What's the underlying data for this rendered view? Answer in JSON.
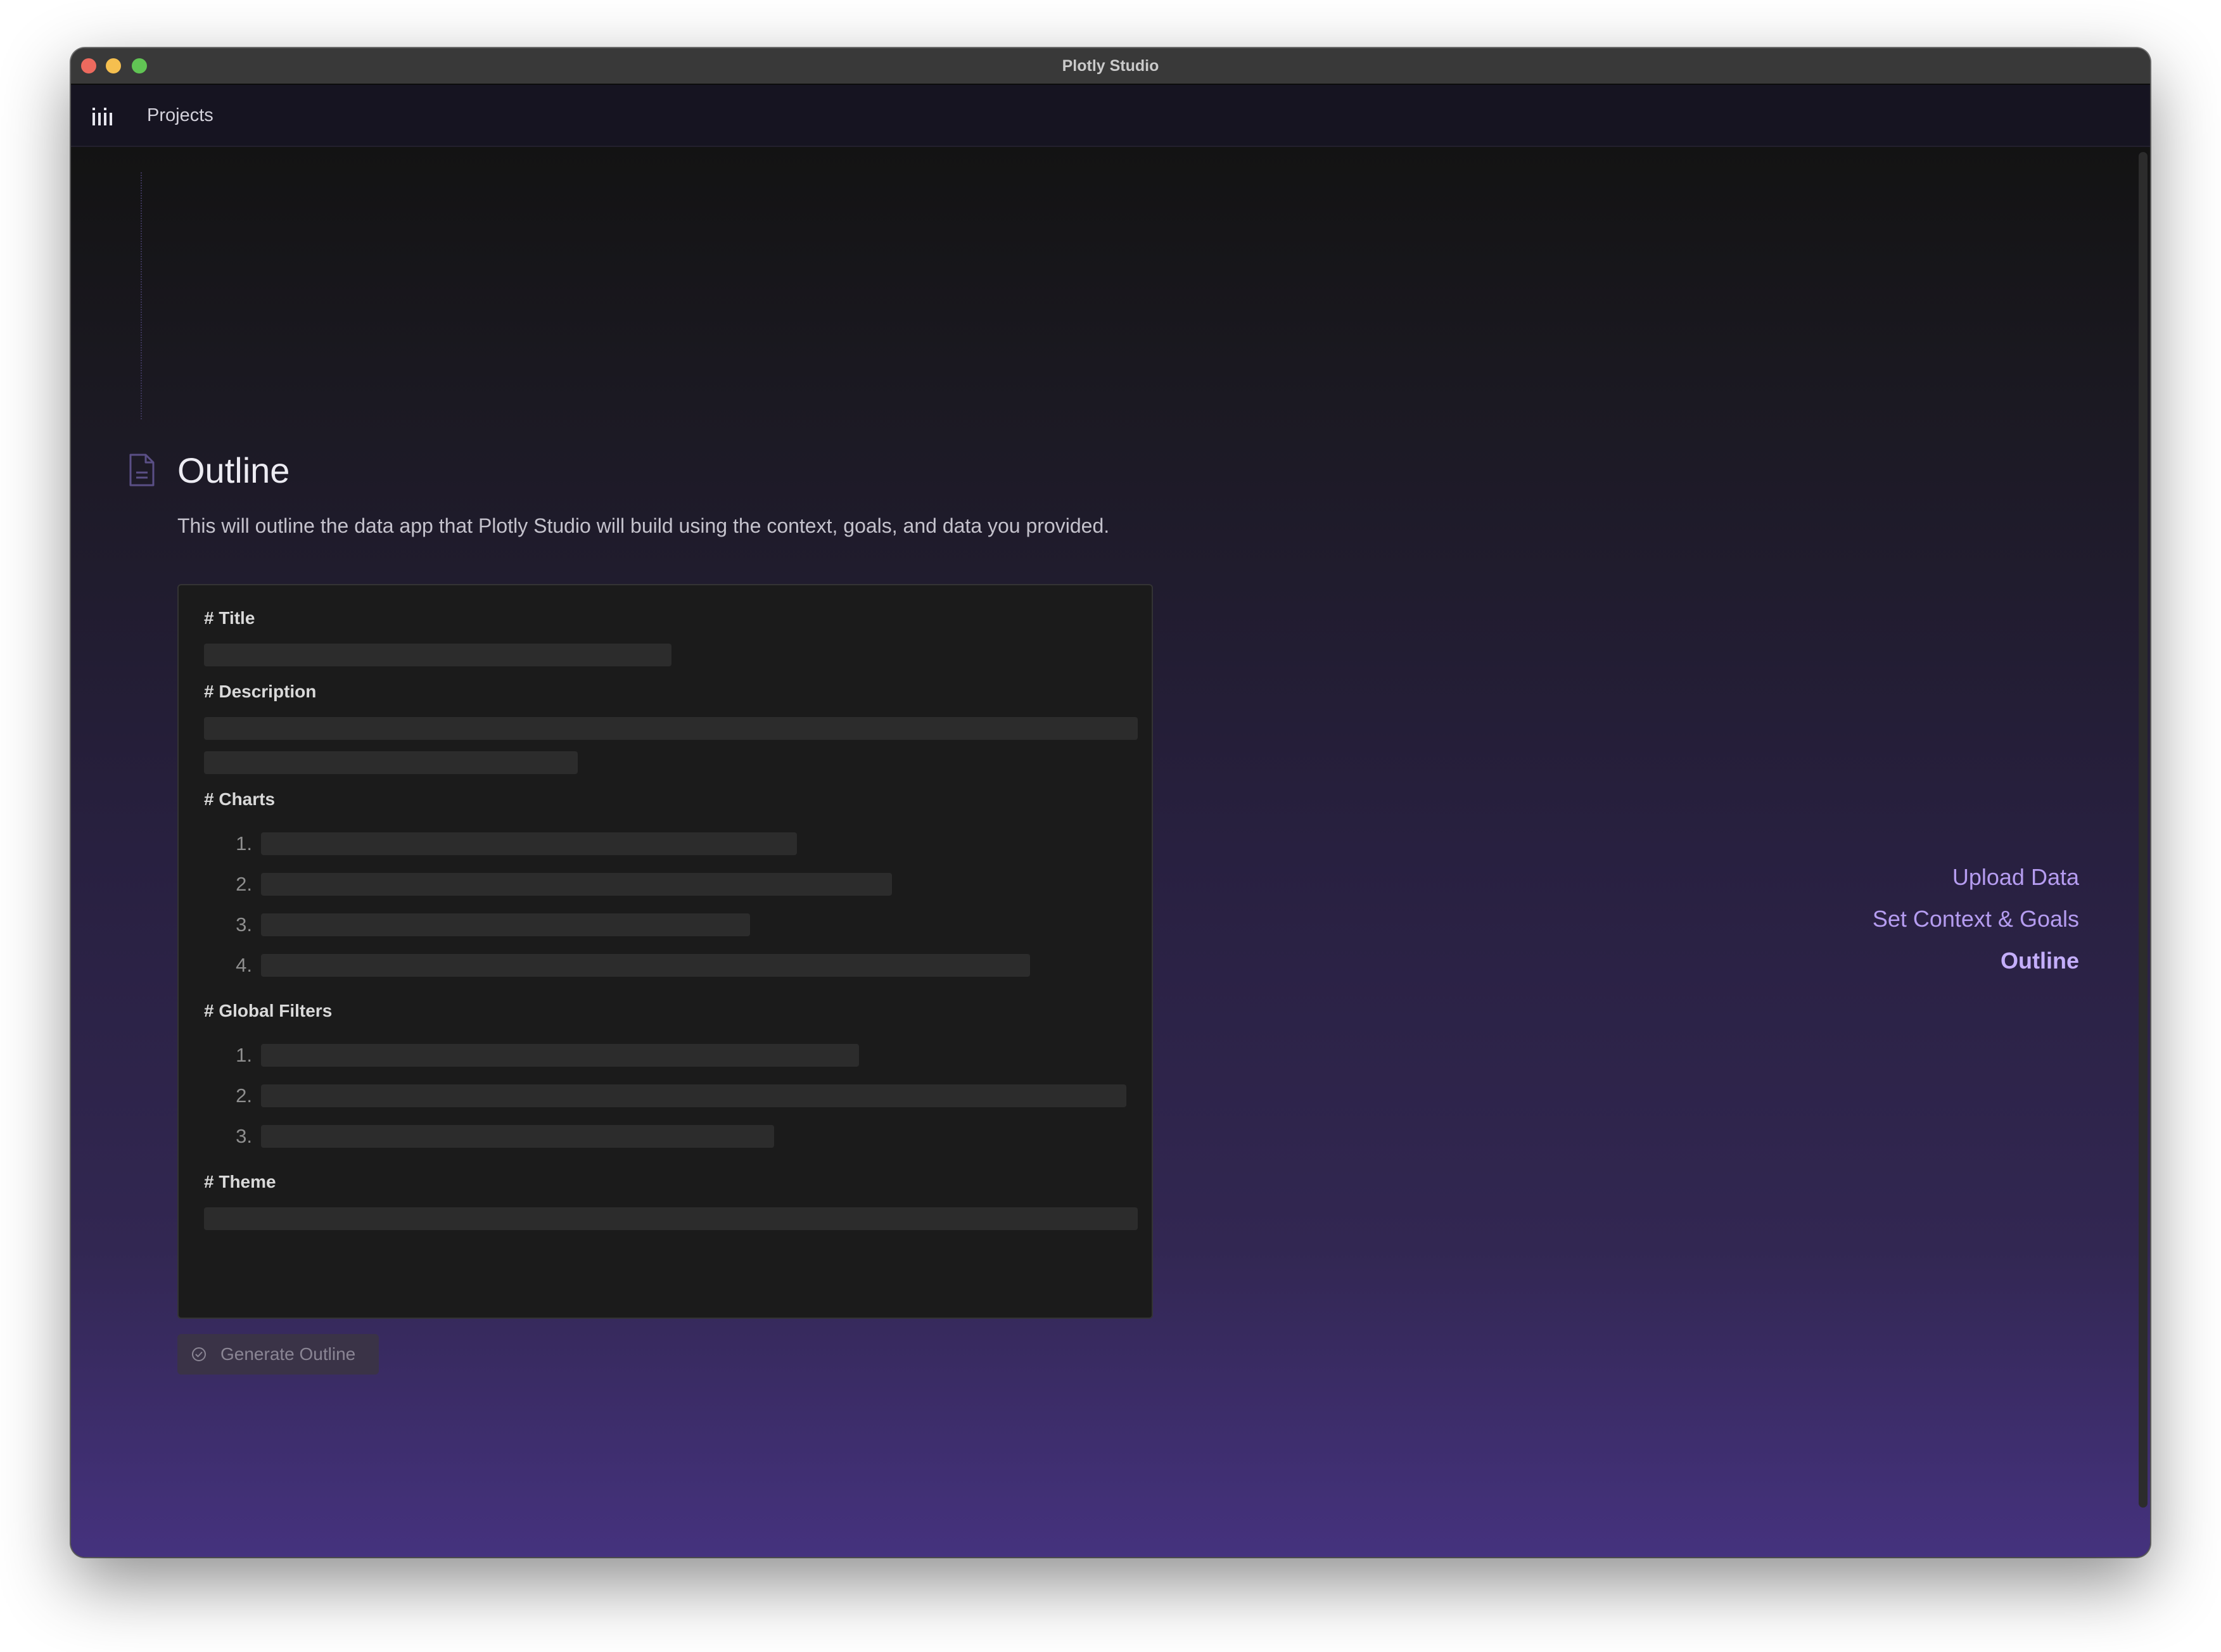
{
  "window": {
    "title": "Plotly Studio"
  },
  "nav": {
    "projects_label": "Projects"
  },
  "section": {
    "title": "Outline",
    "description": "This will outline the data app that Plotly Studio will build using the context, goals, and data you provided."
  },
  "outline": {
    "title_heading": "# Title",
    "description_heading": "# Description",
    "charts_heading": "# Charts",
    "charts_numbers": [
      "1.",
      "2.",
      "3.",
      "4."
    ],
    "filters_heading": "# Global Filters",
    "filters_numbers": [
      "1.",
      "2.",
      "3."
    ],
    "theme_heading": "# Theme"
  },
  "actions": {
    "generate_label": "Generate Outline"
  },
  "steps": {
    "upload": "Upload Data",
    "context": "Set Context & Goals",
    "outline": "Outline"
  },
  "colors": {
    "accent": "#b59cf0",
    "active_step": "#c4aefb",
    "skeleton": "#2c2c2c"
  },
  "icons": {
    "logo": "plotly-bars-icon",
    "section": "document-icon",
    "generate": "check-circle-icon"
  }
}
